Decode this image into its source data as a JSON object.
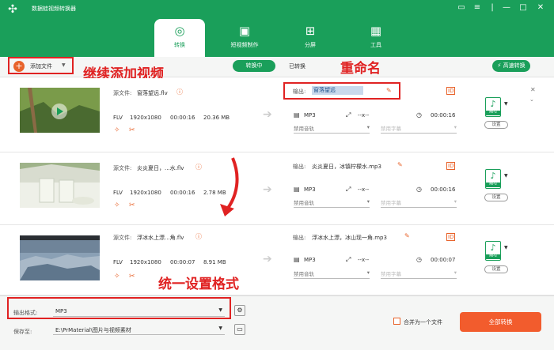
{
  "app": {
    "title": "数据蛙视频转换器"
  },
  "tabs": [
    {
      "label": "转换",
      "icon": "convert-icon"
    },
    {
      "label": "短视频制作",
      "icon": "video-maker-icon"
    },
    {
      "label": "分屏",
      "icon": "split-screen-icon"
    },
    {
      "label": "工具",
      "icon": "toolbox-icon"
    }
  ],
  "toolbar": {
    "add_file": "添加文件",
    "converting": "转换中",
    "converted": "已转换",
    "fast_convert": "高速转换"
  },
  "annotations": {
    "continue_add": "继续添加视频",
    "rename": "重命名",
    "unified_format": "统一设置格式"
  },
  "labels": {
    "source_file": "源文件:",
    "output": "输出:",
    "audio_disabled": "禁用音轨",
    "subtitle_disabled": "禁用字幕",
    "settings": "设置",
    "dimension_placeholder": "--x--"
  },
  "files": [
    {
      "source_name": "窗落望远.flv",
      "format": "FLV",
      "resolution": "1920x1080",
      "duration": "00:00:16",
      "size": "20.36 MB",
      "output_name": "窗落望远",
      "output_format": "MP3",
      "output_duration": "00:00:16",
      "thumb_colors": [
        "#6c8f3f",
        "#3a5a2a",
        "#b89b6a"
      ]
    },
    {
      "source_name": "炎炎夏日，...水.flv",
      "format": "FLV",
      "resolution": "1920x1080",
      "duration": "00:00:16",
      "size": "2.78 MB",
      "output_name": "炎炎夏日，冰镇柠檬水.mp3",
      "output_format": "MP3",
      "output_duration": "00:00:16",
      "thumb_colors": [
        "#d8dccf",
        "#9fb38a",
        "#eef0e8"
      ]
    },
    {
      "source_name": "浮冰水上漂...角.flv",
      "format": "FLV",
      "resolution": "1920x1080",
      "duration": "00:00:07",
      "size": "8.91 MB",
      "output_name": "浮冰水上漂，冰山现一角.mp3",
      "output_format": "MP3",
      "output_duration": "00:00:07",
      "thumb_colors": [
        "#7d95ad",
        "#a7b7c6",
        "#5f768c"
      ]
    }
  ],
  "footer": {
    "output_format_label": "输出格式:",
    "output_format_value": "MP3",
    "save_to_label": "保存至:",
    "save_path": "E:\\PrMaterial\\图片与视频素材",
    "merge_label": "合并为一个文件",
    "convert_all": "全部转换"
  },
  "colors": {
    "brand": "#1a9f5a",
    "accent": "#f25c2d",
    "annotation": "#e02222"
  }
}
